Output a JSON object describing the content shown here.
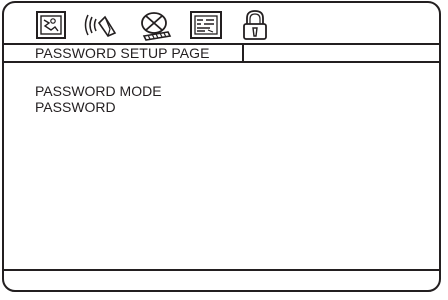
{
  "tabs": [
    {
      "id": "general",
      "icon": "general-setup-icon",
      "active": false
    },
    {
      "id": "audio",
      "icon": "audio-speaker-icon",
      "active": false
    },
    {
      "id": "video",
      "icon": "video-disc-icon",
      "active": false
    },
    {
      "id": "preference",
      "icon": "preference-grid-icon",
      "active": false
    },
    {
      "id": "password",
      "icon": "padlock-icon",
      "active": true
    }
  ],
  "page": {
    "title": "PASSWORD SETUP PAGE"
  },
  "menu": {
    "items": [
      {
        "id": "password-mode",
        "label": "PASSWORD MODE"
      },
      {
        "id": "password",
        "label": "PASSWORD"
      }
    ]
  },
  "status_text": ""
}
